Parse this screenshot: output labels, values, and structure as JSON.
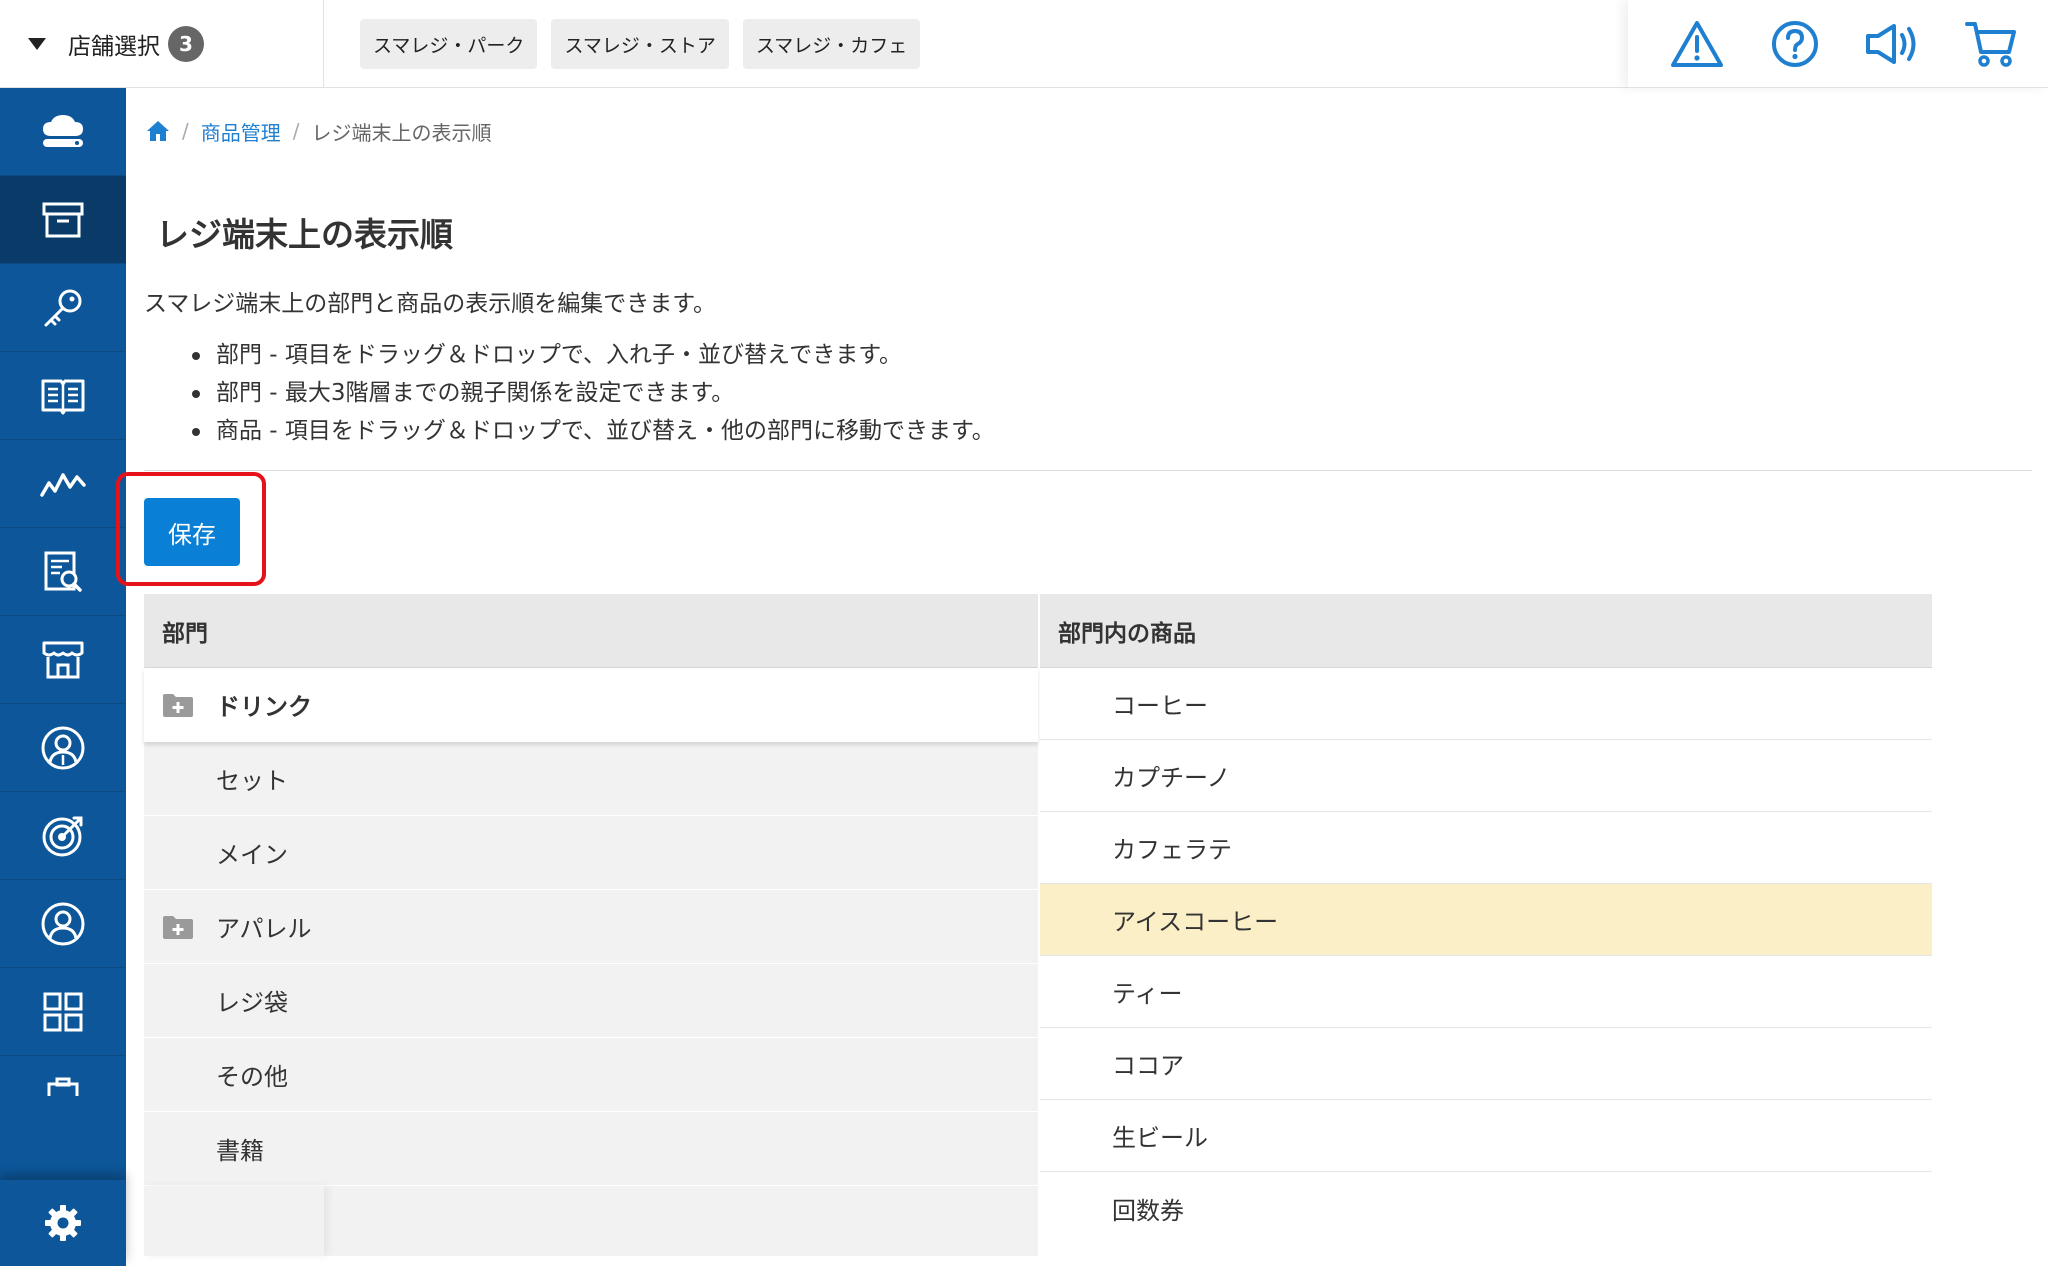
{
  "header": {
    "store_select_label": "店舗選択",
    "store_count": "3",
    "stores": [
      "スマレジ・パーク",
      "スマレジ・ストア",
      "スマレジ・カフェ"
    ],
    "icons": [
      "warning-icon",
      "help-icon",
      "announcement-icon",
      "cart-icon"
    ]
  },
  "sidebar": {
    "items": [
      "cloud-icon",
      "product-box-icon",
      "key-icon",
      "book-icon",
      "analytics-icon",
      "report-icon",
      "store-icon",
      "customer-icon",
      "target-icon",
      "staff-icon",
      "apps-icon"
    ],
    "active_index": 1,
    "bottom": "settings-icon"
  },
  "breadcrumb": {
    "home": "home-icon",
    "parent": "商品管理",
    "current": "レジ端末上の表示順"
  },
  "page": {
    "title": "レジ端末上の表示順",
    "description": "スマレジ端末上の部門と商品の表示順を編集できます。",
    "bullets": [
      "部門 - 項目をドラッグ＆ドロップで、入れ子・並び替えできます。",
      "部門 - 最大3階層までの親子関係を設定できます。",
      "商品 - 項目をドラッグ＆ドロップで、並び替え・他の部門に移動できます。"
    ],
    "save_label": "保存"
  },
  "table": {
    "dept_header": "部門",
    "products_header": "部門内の商品",
    "departments": [
      {
        "name": "ドリンク",
        "folder": true,
        "selected": true
      },
      {
        "name": "セット",
        "folder": false
      },
      {
        "name": "メイン",
        "folder": false
      },
      {
        "name": "アパレル",
        "folder": true
      },
      {
        "name": "レジ袋",
        "folder": false
      },
      {
        "name": "その他",
        "folder": false
      },
      {
        "name": "書籍",
        "folder": false
      }
    ],
    "products": [
      {
        "name": "コーヒー"
      },
      {
        "name": "カプチーノ"
      },
      {
        "name": "カフェラテ"
      },
      {
        "name": "アイスコーヒー",
        "highlighted": true
      },
      {
        "name": "ティー"
      },
      {
        "name": "ココア"
      },
      {
        "name": "生ビール"
      },
      {
        "name": "回数券"
      }
    ]
  },
  "colors": {
    "sidebar": "#0c5699",
    "accent": "#0a7fd6",
    "highlight_row": "#fbefc7",
    "annotation": "#e5121a"
  }
}
